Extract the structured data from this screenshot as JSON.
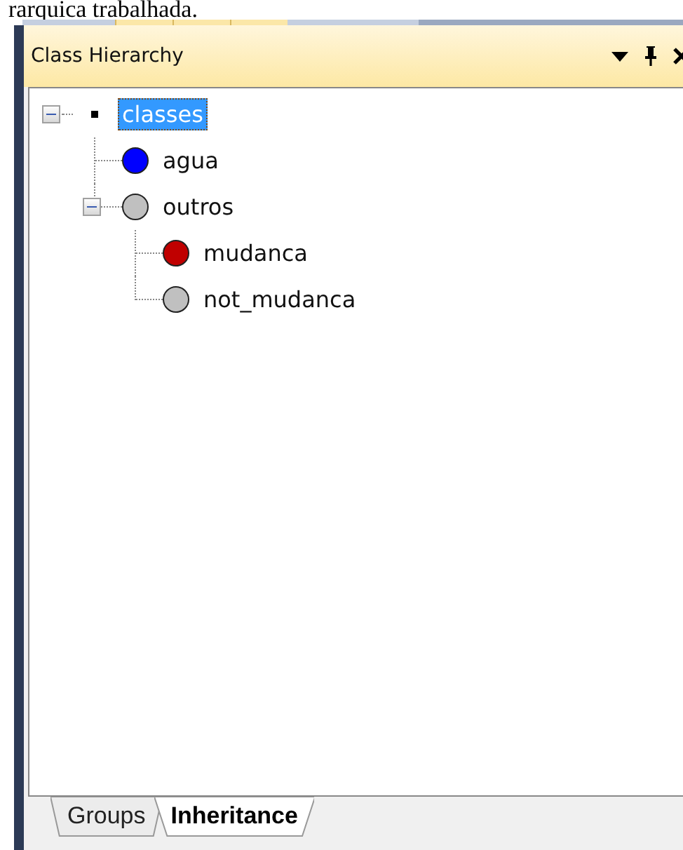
{
  "caption": "rarquica trabalhada.",
  "panel": {
    "title": "Class Hierarchy"
  },
  "tree": {
    "label": "classes",
    "kind": "root",
    "selected": true,
    "expanded": true,
    "children": [
      {
        "label": "agua",
        "kind": "class",
        "color": "#0000ff",
        "selected": false
      },
      {
        "label": "outros",
        "kind": "class",
        "color": "#c0c0c0",
        "selected": false,
        "expanded": true,
        "children": [
          {
            "label": "mudanca",
            "kind": "class",
            "color": "#c00000",
            "selected": false
          },
          {
            "label": "not_mudanca",
            "kind": "class",
            "color": "#c0c0c0",
            "selected": false
          }
        ]
      }
    ]
  },
  "tabs": [
    {
      "label": "Groups",
      "selected": false
    },
    {
      "label": "Inheritance",
      "selected": true
    }
  ]
}
